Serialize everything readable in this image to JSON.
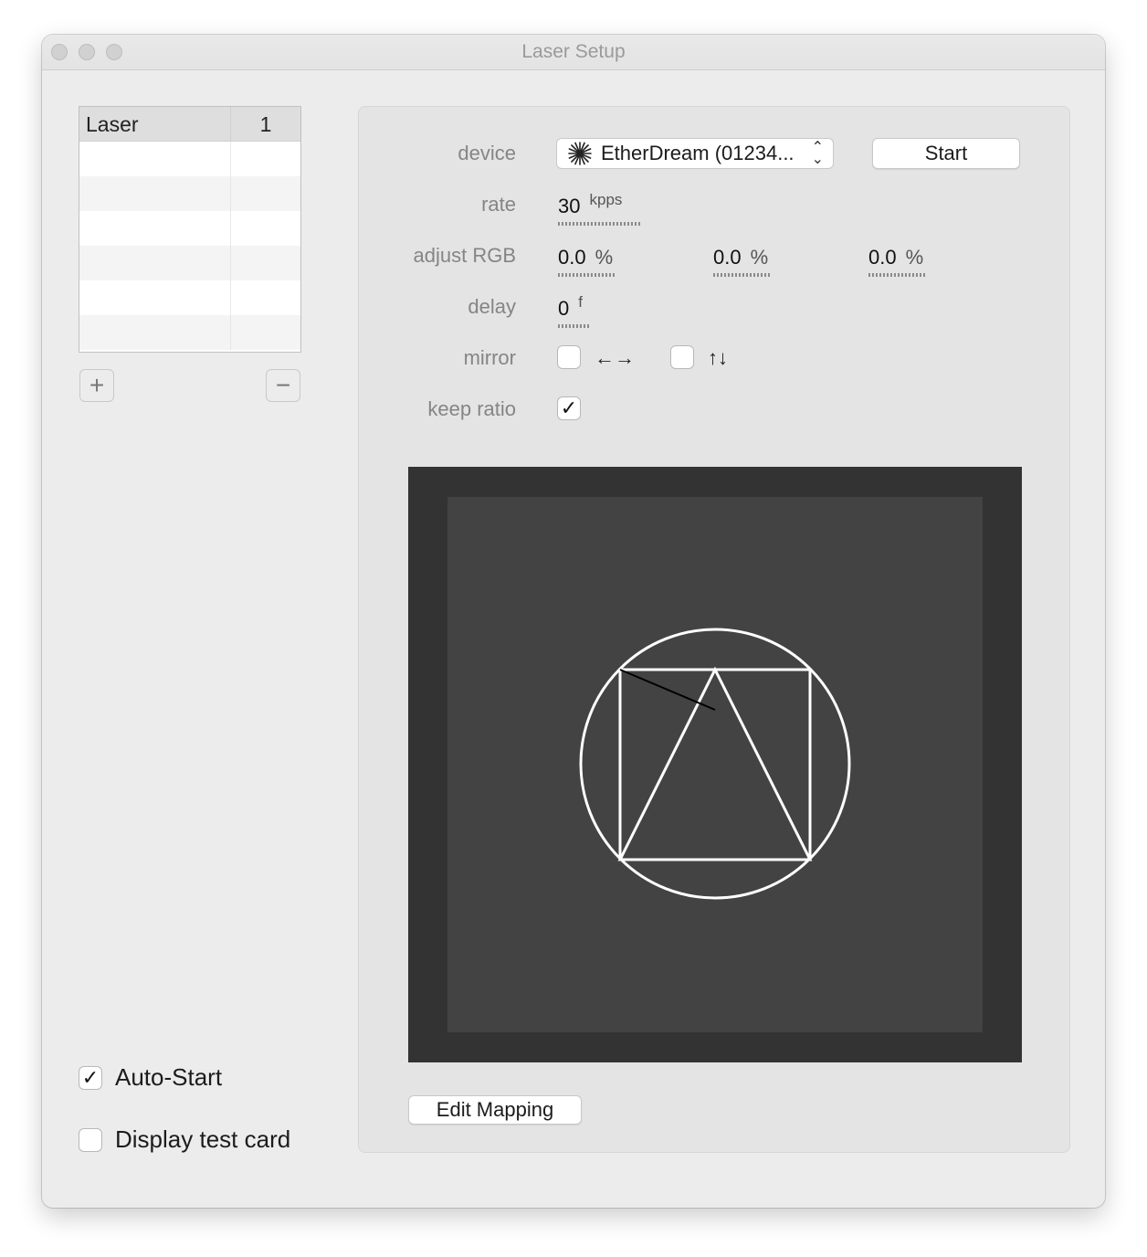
{
  "window": {
    "title": "Laser Setup"
  },
  "laser_list": {
    "columns": [
      "Laser",
      "1"
    ],
    "rows": [],
    "add_label": "+",
    "remove_label": "−"
  },
  "options": {
    "auto_start": {
      "label": "Auto-Start",
      "checked": true
    },
    "display_test_card": {
      "label": "Display test card",
      "checked": false
    }
  },
  "settings": {
    "device": {
      "label": "device",
      "value": "EtherDream (01234...",
      "icon": "laser-burst-icon"
    },
    "start_button": "Start",
    "rate": {
      "label": "rate",
      "value": "30",
      "unit": "kpps"
    },
    "adjust_rgb": {
      "label": "adjust RGB",
      "values": [
        "0.0",
        "0.0",
        "0.0"
      ],
      "unit": "%"
    },
    "delay": {
      "label": "delay",
      "value": "0",
      "unit": "f"
    },
    "mirror": {
      "label": "mirror",
      "horizontal": {
        "arrows": "←→",
        "checked": false
      },
      "vertical": {
        "arrows": "↑↓",
        "checked": false
      }
    },
    "keep_ratio": {
      "label": "keep ratio",
      "checked": true
    }
  },
  "preview": {
    "background": "#333333",
    "canvas": "#434343",
    "stroke": "#ffffff"
  },
  "edit_mapping_button": "Edit Mapping",
  "check_glyph": "✓"
}
